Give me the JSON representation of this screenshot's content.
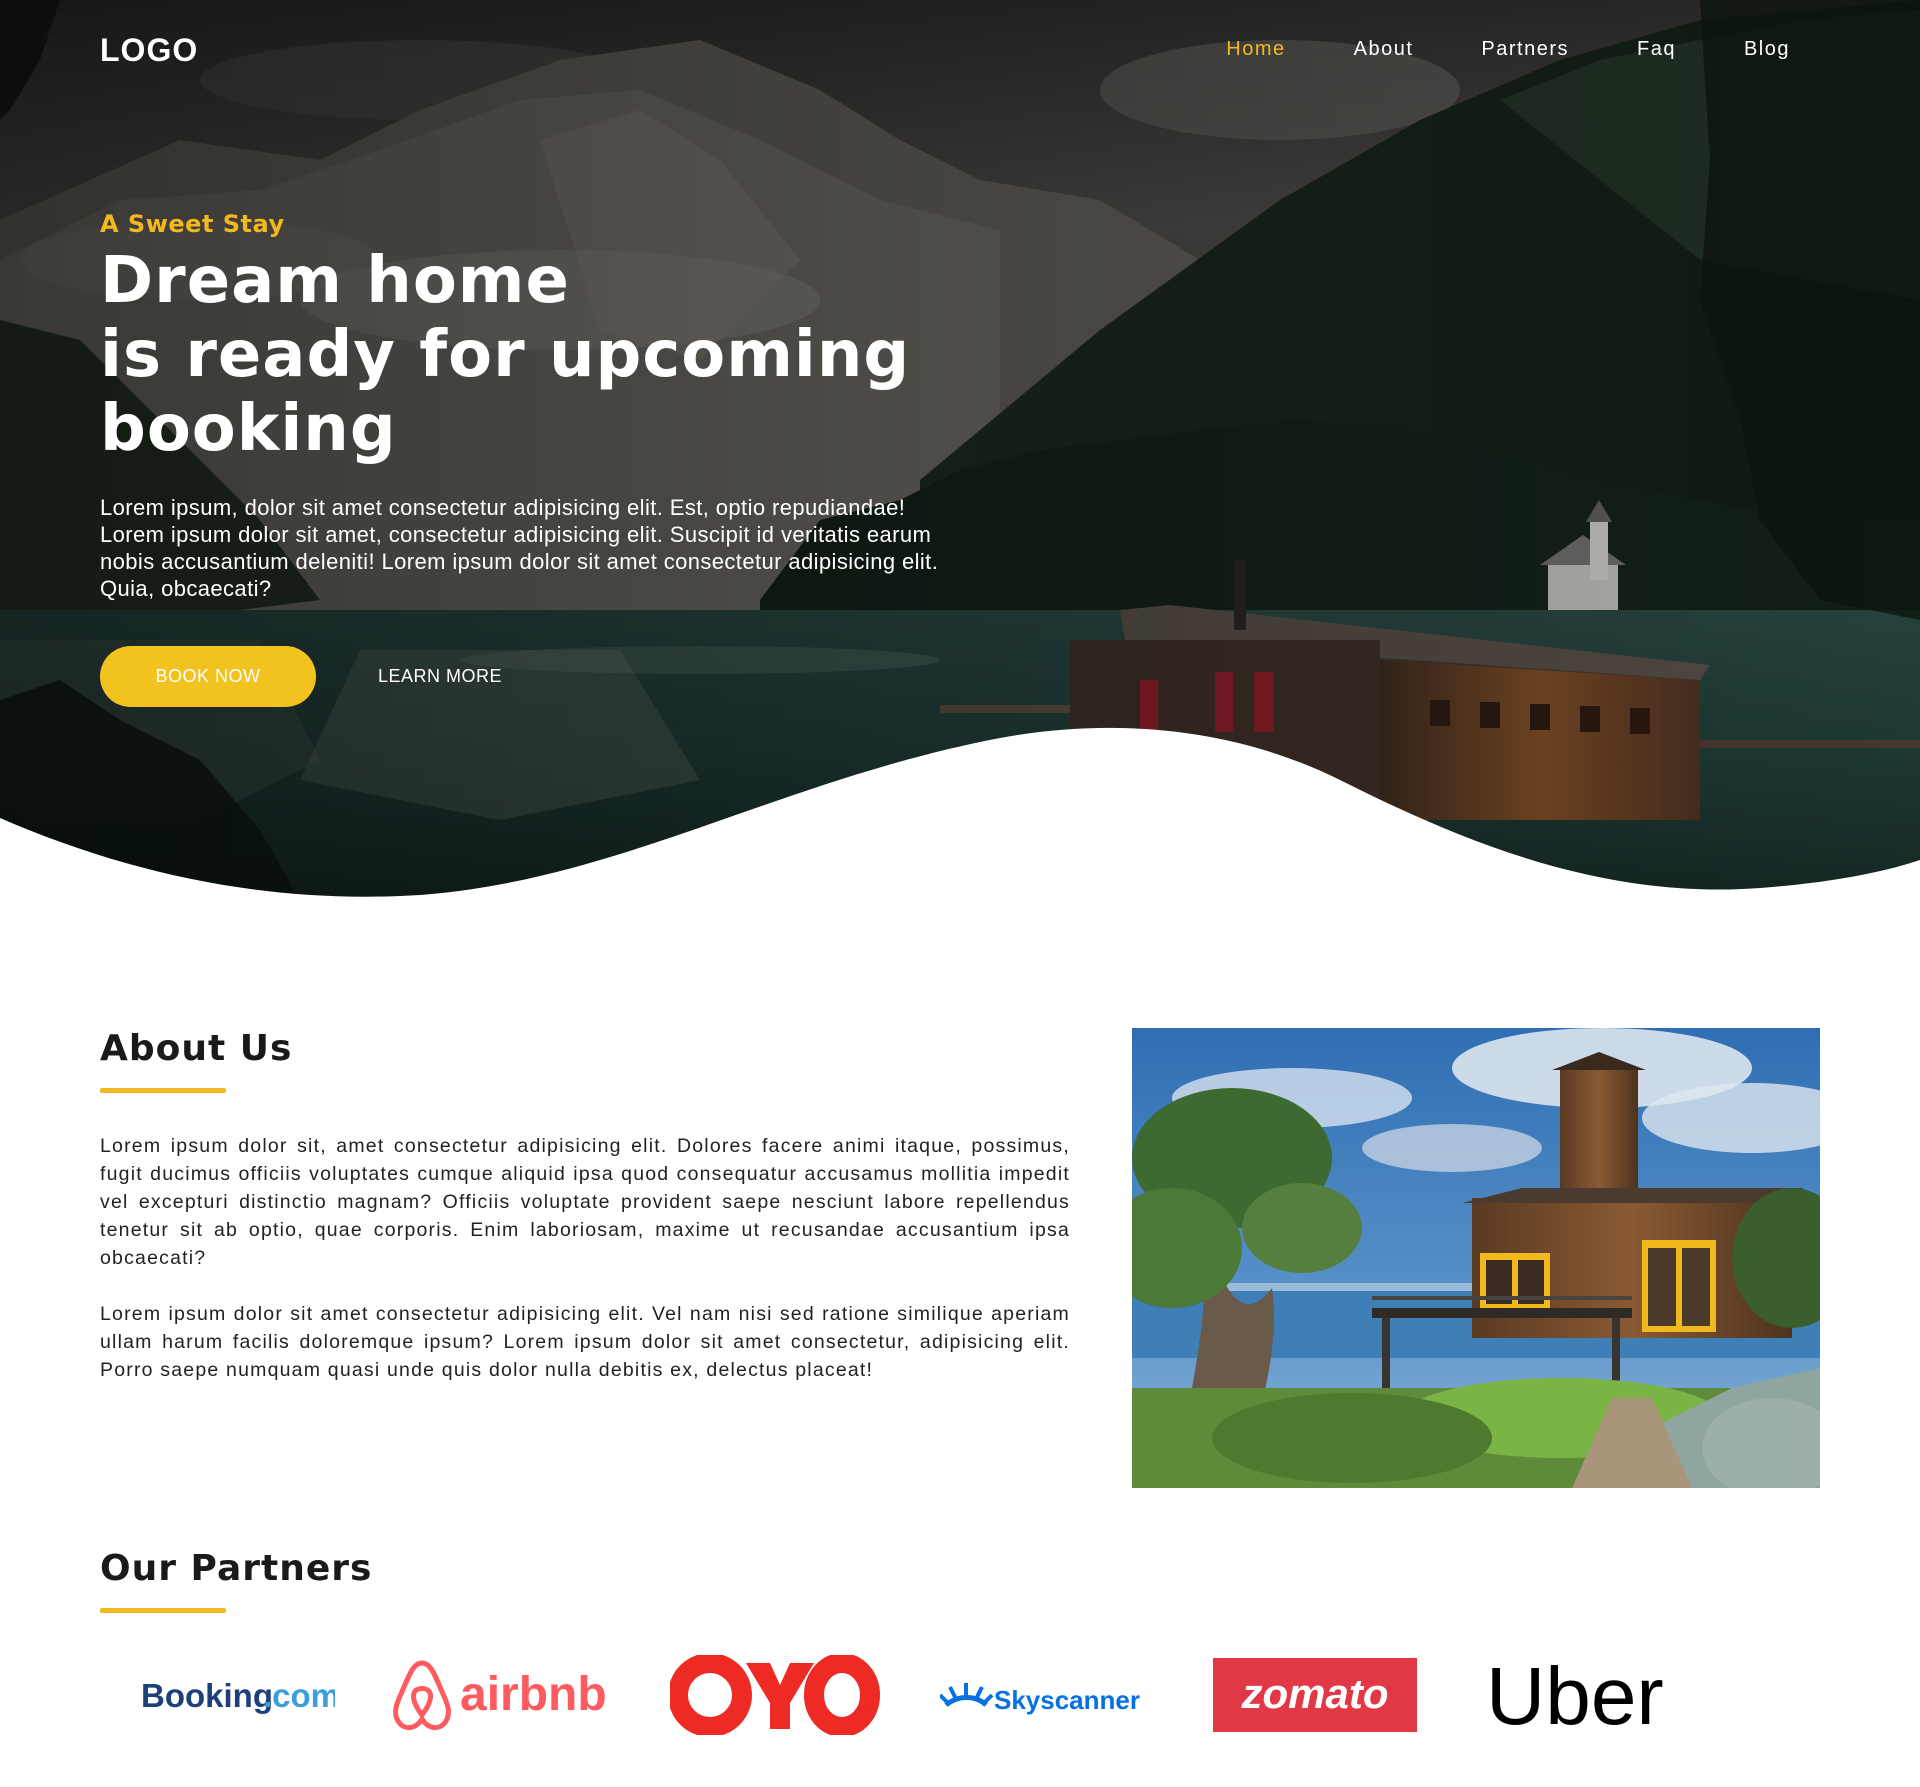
{
  "nav": {
    "logo": "LOGO",
    "links": [
      "Home",
      "About",
      "Partners",
      "Faq",
      "Blog"
    ],
    "active": "Home"
  },
  "hero": {
    "tagline": "A Sweet Stay",
    "title_lines": [
      "Dream home",
      "is ready for upcoming",
      "booking"
    ],
    "text": "Lorem ipsum, dolor sit amet consectetur adipisicing elit. Est, optio repudiandae! Lorem ipsum dolor sit amet, consectetur adipisicing elit. Suscipit id veritatis earum nobis accusantium deleniti! Lorem ipsum dolor sit amet consectetur adipisicing elit. Quia, obcaecati?",
    "book_button": "BOOK NOW",
    "learn_button": "LEARN MORE"
  },
  "about": {
    "title": "About Us",
    "paragraphs": [
      "Lorem ipsum dolor sit, amet consectetur adipisicing elit. Dolores facere animi itaque, possimus, fugit ducimus officiis voluptates cumque aliquid ipsa quod consequatur accusamus mollitia impedit vel excepturi distinctio magnam? Officiis voluptate provident saepe nesciunt labore repellendus tenetur sit ab optio, quae corporis. Enim laboriosam, maxime ut recusandae accusantium ipsa obcaecati?",
      "Lorem ipsum dolor sit amet consectetur adipisicing elit. Vel nam nisi sed ratione similique aperiam ullam harum facilis doloremque ipsum? Lorem ipsum dolor sit amet consectetur, adipisicing elit. Porro saepe numquam quasi unde quis dolor nulla debitis ex, delectus placeat!"
    ]
  },
  "partners": {
    "title": "Our Partners",
    "logos": [
      "Booking.com",
      "airbnb",
      "OYO",
      "Skyscanner",
      "zomato",
      "Uber"
    ]
  },
  "colors": {
    "accent": "#f2b91f",
    "button": "#f2c21f",
    "booking_blue": "#1d3f7c",
    "booking_light": "#3a9fdc",
    "airbnb": "#ff5a5f",
    "oyo": "#ee2a24",
    "skyscanner": "#0770e3",
    "zomato": "#e23744",
    "uber": "#000000"
  }
}
